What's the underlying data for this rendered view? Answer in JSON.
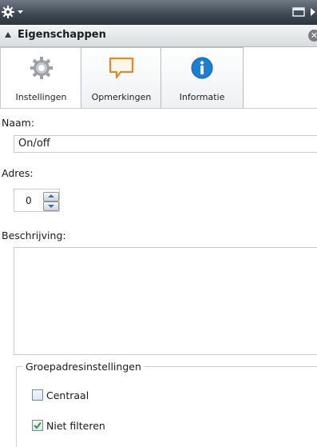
{
  "panel": {
    "title": "Eigenschappen"
  },
  "tabs": [
    {
      "label": "Instellingen",
      "icon": "settings-gear-icon",
      "active": true
    },
    {
      "label": "Opmerkingen",
      "icon": "comment-bubble-icon",
      "active": false
    },
    {
      "label": "Informatie",
      "icon": "info-icon",
      "active": false
    }
  ],
  "form": {
    "name_label": "Naam:",
    "name_value": "On/off",
    "address_label": "Adres:",
    "address_value": "0",
    "description_label": "Beschrijving:",
    "description_value": "",
    "group_title": "Groepadresinstellingen",
    "central_label": "Centraal",
    "central_checked": false,
    "nofilter_label": "Niet filteren",
    "nofilter_checked": true
  },
  "colors": {
    "toolbar": "#3e4853",
    "accent_blue": "#1c7fd1",
    "comment_orange": "#e08a2e",
    "check_green": "#2f9a2f"
  }
}
